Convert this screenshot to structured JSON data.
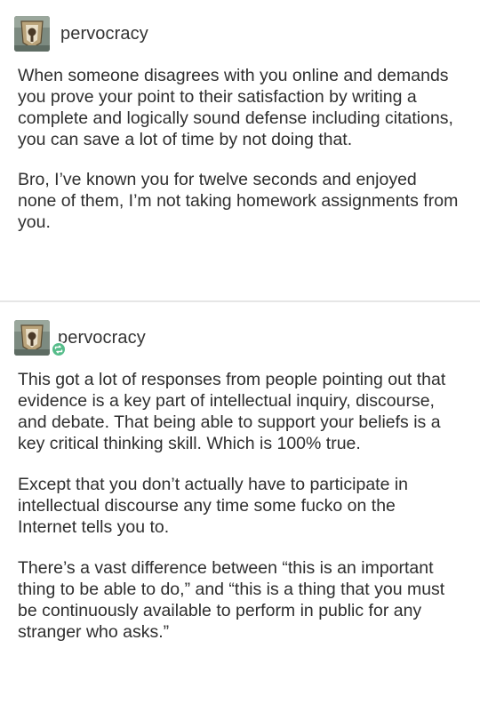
{
  "posts": [
    {
      "username": "pervocracy",
      "avatar_icon": "user-avatar-icon",
      "paragraphs": [
        "When someone disagrees with you online and demands you prove your point to their satisfaction by writing a complete and logically sound defense including citations, you can save a lot of time by not doing that.",
        "Bro, I’ve known you for twelve seconds and enjoyed none of them, I’m not taking homework assignments from you."
      ]
    },
    {
      "username": "pervocracy",
      "avatar_icon": "user-avatar-icon",
      "badge_icon": "reblog-icon",
      "paragraphs": [
        "This got a lot of responses from people pointing out that evidence is a key part of intellectual inquiry, discourse, and debate. That being able to support your beliefs is a key critical thinking skill. Which is 100% true.",
        "Except that you don’t actually have to participate in intellectual discourse any time some fucko on the Internet tells you to.",
        "There’s a vast difference between “this is an important thing to be able to do,” and “this is a thing that you must be continuously available to perform in public for any stranger who asks.”"
      ]
    }
  ],
  "colors": {
    "badge": "#56bc8a",
    "text": "#2e2e2e",
    "divider": "#e6e6e6"
  }
}
